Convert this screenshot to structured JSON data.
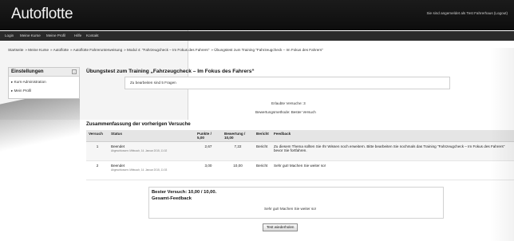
{
  "header": {
    "logo": "Autoflotte",
    "login_info": "Sie sind angemeldet als Test Fahrerhaus (Logout)"
  },
  "nav": {
    "items": [
      "Login",
      "Meine Kurse",
      "Meine Profil",
      "Hilfe",
      "Kontakt"
    ]
  },
  "breadcrumb": [
    "Startseite",
    "Meine Kurse",
    "Autoflotte",
    "Autoflotte Fahrerunterweisung",
    "Modul 4: \"Fahrzeugcheck – Im Fokus des Fahrers\"",
    "Übungstest zum Training \"Fahrzeugcheck – Im Fokus des Fahrers\""
  ],
  "sidebar": {
    "title": "Einstellungen",
    "items": [
      "Kurs-Administration",
      "Mein Profil"
    ]
  },
  "quiz": {
    "title": "Übungstest zum Training „Fahrzeugcheck – Im Fokus des Fahrers“",
    "info": "Zu bearbeiten sind 5 Fragen",
    "attempts_allowed": "Erlaubte Versuche: 3",
    "grading_method": "Bewertungsmethode: Bester Versuch"
  },
  "summary": {
    "title": "Zusammenfassung der vorherigen Versuche",
    "columns": [
      "Versuch",
      "Status",
      "Punkte / 5,00",
      "Bewertung / 10,00",
      "Bericht",
      "Feedback"
    ],
    "rows": [
      {
        "attempt": "1",
        "status": "Beendet",
        "submitted": "Abgeschlossen: Mittwoch, 14. Januar 2015, 11:02",
        "points": "2,67",
        "grade": "7,22",
        "review": "Bericht",
        "feedback": "Zu diesem Thema sollten Sie Ihr Wissen noch erweitern. Bitte bearbeiten Sie nochmals das Training \"Fahrzeugcheck – Im Fokus des Fahrers\" bevor Sie fortfahren."
      },
      {
        "attempt": "2",
        "status": "Beendet",
        "submitted": "Abgeschlossen: Mittwoch, 14. Januar 2015, 11:03",
        "points": "3,00",
        "grade": "10,00",
        "review": "Bericht",
        "feedback": "Sehr gut! Machen Sie weiter so!"
      }
    ]
  },
  "best": {
    "line": "Bester Versuch: 10,00 / 10,00.",
    "overall_label": "Gesamt-Feedback",
    "overall_text": "Sehr gut! Machen Sie weiter so!"
  },
  "retry_button": "Test wiederholen"
}
